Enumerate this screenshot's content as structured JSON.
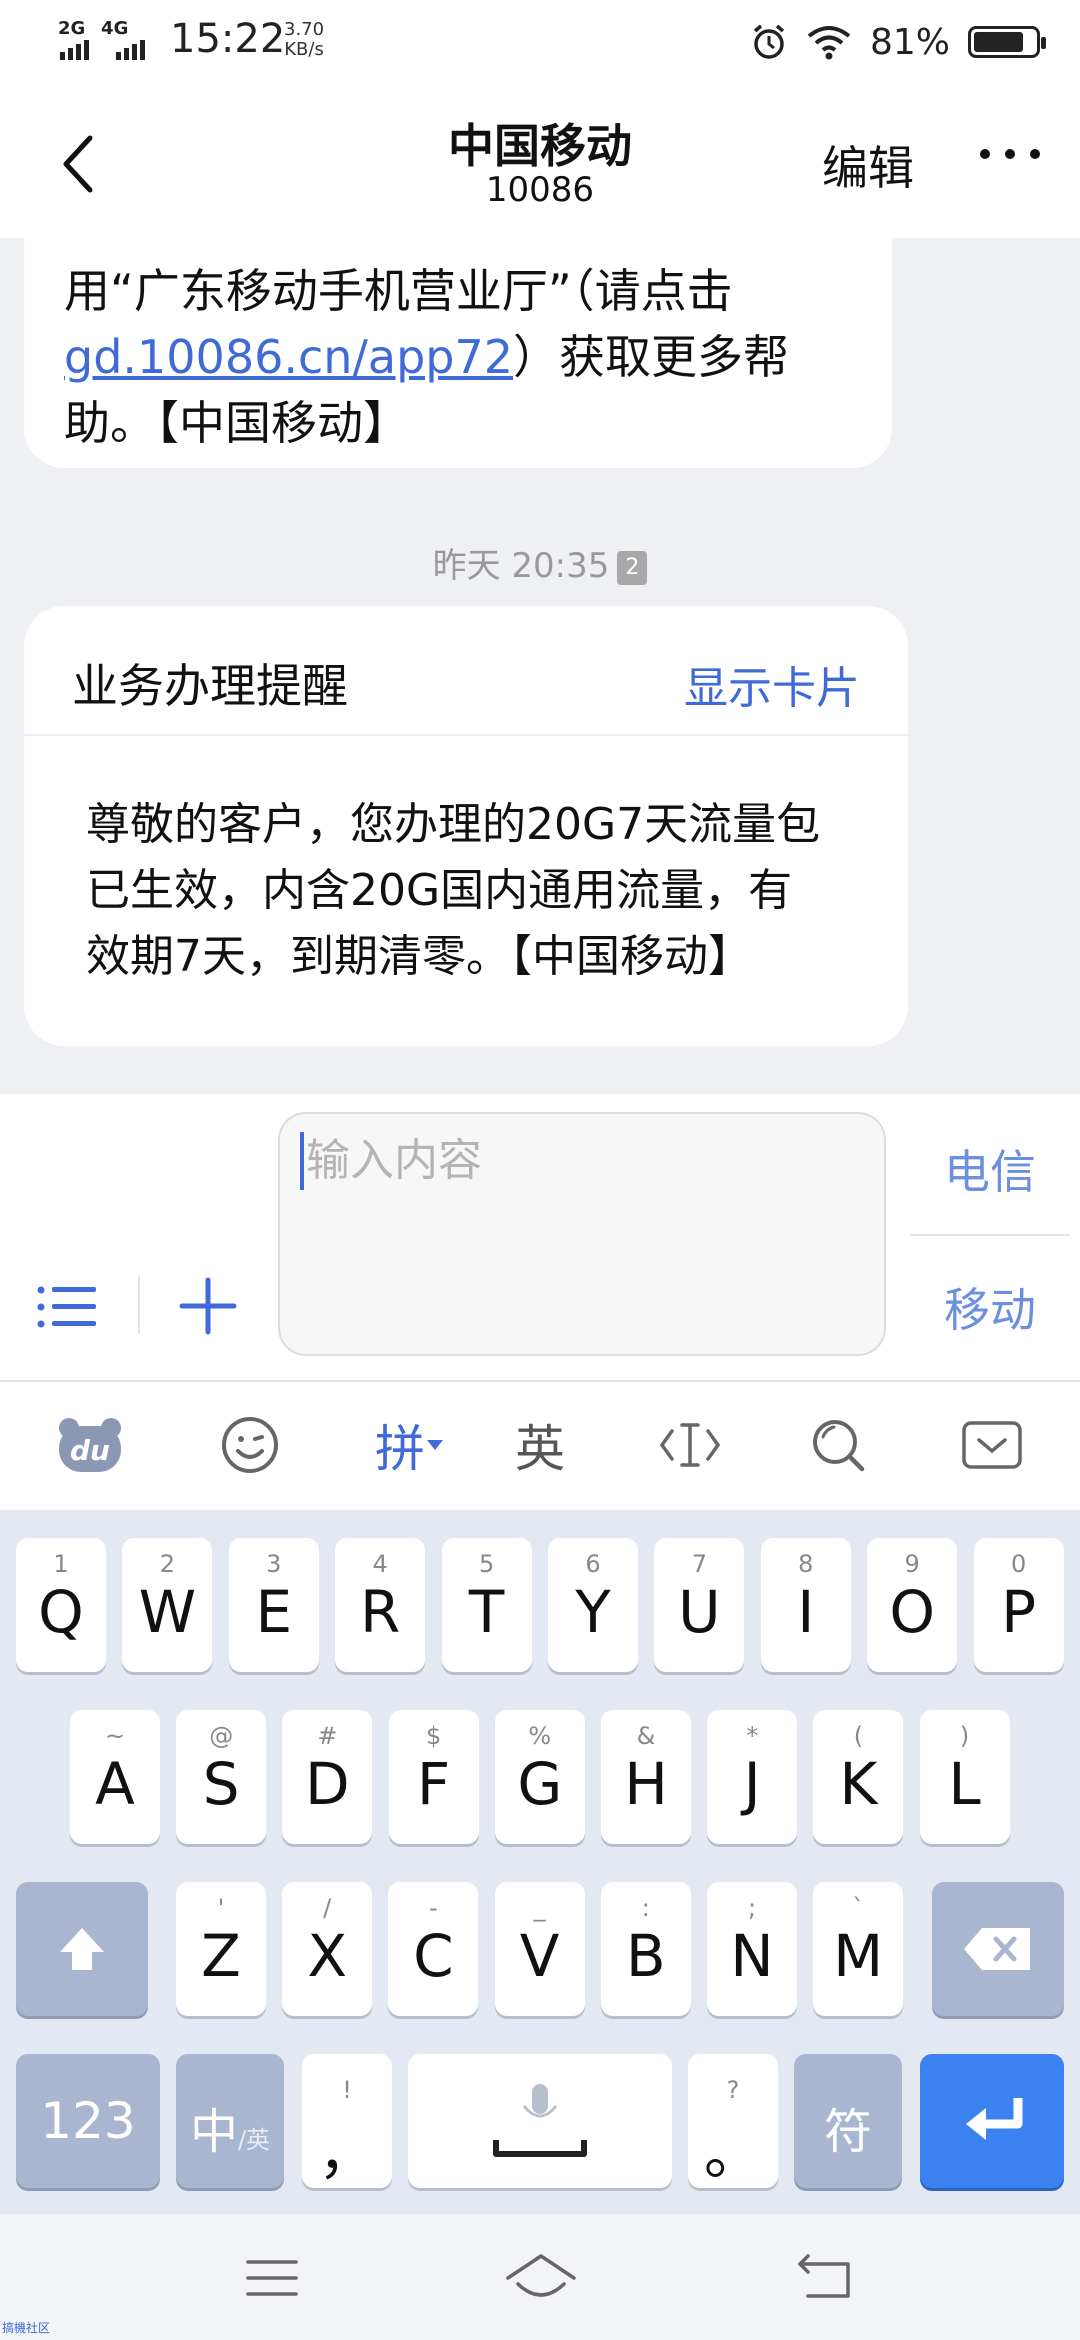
{
  "status_bar": {
    "net1": "2G",
    "net2": "4G",
    "time": "15:22",
    "speed_value": "3.70",
    "speed_unit": "KB/s",
    "battery_pct": "81%",
    "battery_level": 0.81
  },
  "header": {
    "title": "中国移动",
    "subtitle": "10086",
    "edit_label": "编辑"
  },
  "messages": {
    "prev_text_1": "用“广东移动手机营业厅”（请点击",
    "prev_link": "gd.10086.cn/app72",
    "prev_text_2": "）获取更多帮",
    "prev_text_3": "助。【中国移动】",
    "timestamp": "昨天 20:35",
    "timestamp_badge": "2",
    "card_title": "业务办理提醒",
    "card_button": "显示卡片",
    "card_line1": "尊敬的客户，您办理的20G7天流量包",
    "card_line2": "已生效，内含20G国内通用流量，有",
    "card_line3": "效期7天，到期清零。【中国移动】"
  },
  "input": {
    "placeholder": "输入内容",
    "sim1": "电信",
    "sim2": "移动"
  },
  "kb_toolbar": {
    "pinyin": "拼",
    "english": "英"
  },
  "keyboard": {
    "row1": [
      {
        "main": "Q",
        "sub": "1"
      },
      {
        "main": "W",
        "sub": "2"
      },
      {
        "main": "E",
        "sub": "3"
      },
      {
        "main": "R",
        "sub": "4"
      },
      {
        "main": "T",
        "sub": "5"
      },
      {
        "main": "Y",
        "sub": "6"
      },
      {
        "main": "U",
        "sub": "7"
      },
      {
        "main": "I",
        "sub": "8"
      },
      {
        "main": "O",
        "sub": "9"
      },
      {
        "main": "P",
        "sub": "0"
      }
    ],
    "row2": [
      {
        "main": "A",
        "sub": "~"
      },
      {
        "main": "S",
        "sub": "@"
      },
      {
        "main": "D",
        "sub": "#"
      },
      {
        "main": "F",
        "sub": "$"
      },
      {
        "main": "G",
        "sub": "%"
      },
      {
        "main": "H",
        "sub": "&"
      },
      {
        "main": "J",
        "sub": "*"
      },
      {
        "main": "K",
        "sub": "("
      },
      {
        "main": "L",
        "sub": ")"
      }
    ],
    "row3": [
      {
        "main": "Z",
        "sub": "'"
      },
      {
        "main": "X",
        "sub": "/"
      },
      {
        "main": "C",
        "sub": "-"
      },
      {
        "main": "V",
        "sub": "_"
      },
      {
        "main": "B",
        "sub": ":"
      },
      {
        "main": "N",
        "sub": ";"
      },
      {
        "main": "M",
        "sub": "`"
      }
    ],
    "num_label": "123",
    "lang_label": "中",
    "lang_sub": "/英",
    "comma_main": "，",
    "comma_sub": "!",
    "period_main": "。",
    "period_sub": "?",
    "symbol_label": "符"
  },
  "footer": {
    "watermark": "搞機社区"
  },
  "colors": {
    "accent": "#3f6ad8",
    "enter_key": "#3b82f0",
    "dark_key": "#a9b6cf"
  }
}
